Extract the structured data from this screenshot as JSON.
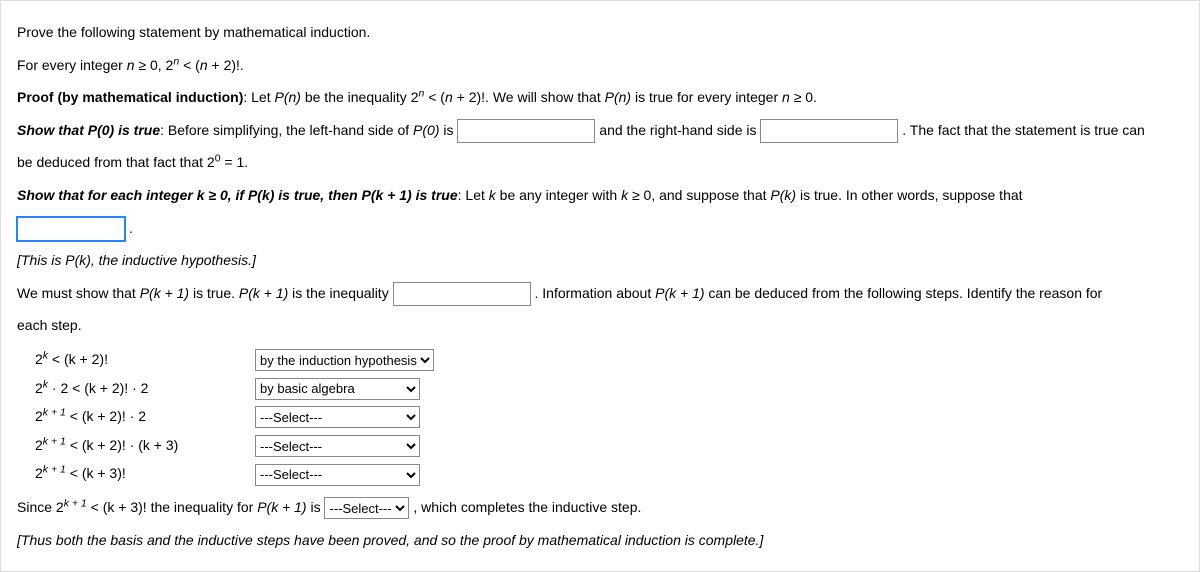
{
  "prompt": "Prove the following statement by mathematical induction.",
  "statement_a": "For every integer ",
  "statement_b": " ≥ 0, 2",
  "statement_c": " < (",
  "statement_d": " + 2)!.",
  "n": "n",
  "proof_label": "Proof (by mathematical induction)",
  "proof_text_a": ": Let ",
  "proof_text_b": " be the inequality 2",
  "proof_text_c": " < (",
  "proof_text_d": " + 2)!. We will show that ",
  "proof_text_e": " is true for every integer ",
  "proof_text_f": " ≥ 0.",
  "Pn": "P(n)",
  "show_p0_label": "Show that P(0) is true",
  "p0_a": ": Before simplifying, the left-hand side of ",
  "p0_p0": "P(0)",
  "p0_b": " is ",
  "p0_c": " and the right-hand side is ",
  "p0_d": " . The fact that the statement is true can",
  "p0_line2_a": "be deduced from that fact that 2",
  "p0_line2_b": " = 1.",
  "zero": "0",
  "show_pk_label": "Show that for each integer k ≥ 0, if P(k) is true, then P(k + 1) is true",
  "pk_a": ": Let ",
  "pk_b": " be any integer with ",
  "pk_c": " ≥ 0, and suppose that ",
  "pk_d": " is true. In other words, suppose that",
  "k": "k",
  "Pk": "P(k)",
  "hypothesis_note": "[This is P(k), the inductive hypothesis.]",
  "must_a": "We must show that ",
  "must_b": " is true. ",
  "must_c": " is the inequality ",
  "must_d": " . Information about ",
  "must_e": " can be deduced from the following steps. Identify the reason for",
  "Pk1": "P(k + 1)",
  "each_step": "each step.",
  "steps": {
    "s1_lhs": "2",
    "s1_exp": "k",
    "s1_rhs": " < (k + 2)!",
    "s2_lhs": "2",
    "s2_exp": "k",
    "s2_mid": " · 2 < (k + 2)! · 2",
    "s3_lhs": "2",
    "s3_exp": "k + 1",
    "s3_rhs": " < (k + 2)! · 2",
    "s4_lhs": "2",
    "s4_exp": "k + 1",
    "s4_rhs": " < (k + 2)! · (k + 3)",
    "s5_lhs": "2",
    "s5_exp": "k + 1",
    "s5_rhs": " < (k + 3)!"
  },
  "reasons": {
    "r1": "by the induction hypothesis",
    "r2": "by basic algebra",
    "placeholder": "---Select---"
  },
  "since_a": "Since 2",
  "since_exp": "k + 1",
  "since_b": " < (k + 3)! the inequality for ",
  "since_c": " is ",
  "since_d": " , which completes the inductive step.",
  "closing": "[Thus both the basis and the inductive steps have been proved, and so the proof by mathematical induction is complete.]"
}
